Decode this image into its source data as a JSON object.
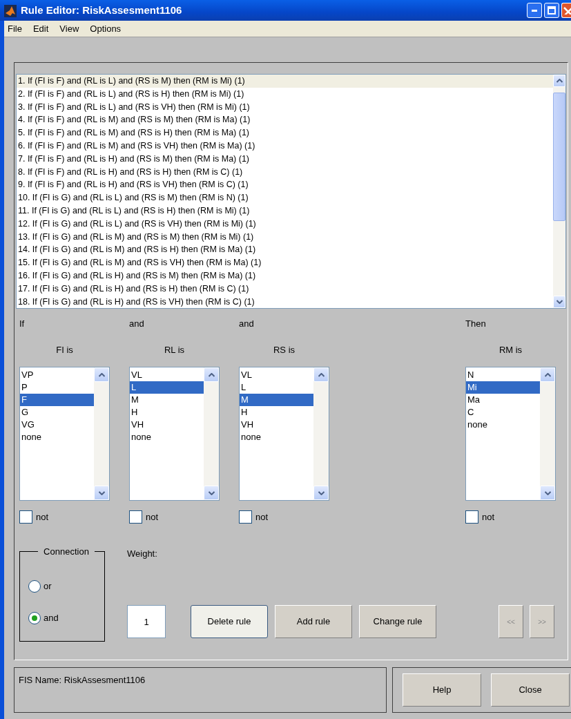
{
  "window": {
    "title": "Rule Editor: RiskAssesment1106"
  },
  "menu": [
    "File",
    "Edit",
    "View",
    "Options"
  ],
  "rules": [
    {
      "text": "1. If (FI is F) and (RL is L) and (RS is M) then (RM is Mi) (1)",
      "selected": true
    },
    {
      "text": "2. If (FI is F) and (RL is L) and (RS is H) then (RM is Mi) (1)",
      "selected": false
    },
    {
      "text": "3. If (FI is F) and (RL is L) and (RS is VH) then (RM is Mi) (1)",
      "selected": false
    },
    {
      "text": "4. If (FI is F) and (RL is M) and (RS is M) then (RM is Ma) (1)",
      "selected": false
    },
    {
      "text": "5. If (FI is F) and (RL is M) and (RS is H) then (RM is Ma) (1)",
      "selected": false
    },
    {
      "text": "6. If (FI is F) and (RL is M) and (RS is VH) then (RM is Ma) (1)",
      "selected": false
    },
    {
      "text": "7. If (FI is F) and (RL is H) and (RS is M) then (RM is Ma) (1)",
      "selected": false
    },
    {
      "text": "8. If (FI is F) and (RL is H) and (RS is H) then (RM is C) (1)",
      "selected": false
    },
    {
      "text": "9. If (FI is F) and (RL is H) and (RS is VH) then (RM is C) (1)",
      "selected": false
    },
    {
      "text": "10. If (FI is G) and (RL is L) and (RS is M) then (RM is N) (1)",
      "selected": false
    },
    {
      "text": "11. If (FI is G) and (RL is L) and (RS is H) then (RM is Mi) (1)",
      "selected": false
    },
    {
      "text": "12. If (FI is G) and (RL is L) and (RS is VH) then (RM is Mi) (1)",
      "selected": false
    },
    {
      "text": "13. If (FI is G) and (RL is M) and (RS is M) then (RM is Mi) (1)",
      "selected": false
    },
    {
      "text": "14. If (FI is G) and (RL is M) and (RS is H) then (RM is Ma) (1)",
      "selected": false
    },
    {
      "text": "15. If (FI is G) and (RL is M) and (RS is VH) then (RM is Ma) (1)",
      "selected": false
    },
    {
      "text": "16. If (FI is G) and (RL is H) and (RS is M) then (RM is Ma) (1)",
      "selected": false
    },
    {
      "text": "17. If (FI is G) and (RL is H) and (RS is H) then (RM is C) (1)",
      "selected": false
    },
    {
      "text": "18. If (FI is G) and (RL is H) and (RS is VH) then (RM is C) (1)",
      "selected": false
    }
  ],
  "columns": [
    {
      "connective": "If",
      "label": "FI is",
      "options": [
        {
          "text": "VP",
          "selected": false
        },
        {
          "text": "P",
          "selected": false
        },
        {
          "text": "F",
          "selected": true
        },
        {
          "text": "G",
          "selected": false
        },
        {
          "text": "VG",
          "selected": false
        },
        {
          "text": "none",
          "selected": false
        }
      ],
      "not": {
        "label": "not",
        "checked": false
      }
    },
    {
      "connective": "and",
      "label": "RL is",
      "options": [
        {
          "text": "VL",
          "selected": false
        },
        {
          "text": "L",
          "selected": true
        },
        {
          "text": "M",
          "selected": false
        },
        {
          "text": "H",
          "selected": false
        },
        {
          "text": "VH",
          "selected": false
        },
        {
          "text": "none",
          "selected": false
        }
      ],
      "not": {
        "label": "not",
        "checked": false
      }
    },
    {
      "connective": "and",
      "label": "RS is",
      "options": [
        {
          "text": "VL",
          "selected": false
        },
        {
          "text": "L",
          "selected": false
        },
        {
          "text": "M",
          "selected": true
        },
        {
          "text": "H",
          "selected": false
        },
        {
          "text": "VH",
          "selected": false
        },
        {
          "text": "none",
          "selected": false
        }
      ],
      "not": {
        "label": "not",
        "checked": false
      }
    },
    {
      "connective": "Then",
      "label": "RM is",
      "options": [
        {
          "text": "N",
          "selected": false
        },
        {
          "text": "Mi",
          "selected": true
        },
        {
          "text": "Ma",
          "selected": false
        },
        {
          "text": "C",
          "selected": false
        },
        {
          "text": "none",
          "selected": false
        }
      ],
      "not": {
        "label": "not",
        "checked": false
      }
    }
  ],
  "connection": {
    "title": "Connection",
    "options": [
      {
        "label": "or",
        "selected": false
      },
      {
        "label": "and",
        "selected": true
      }
    ]
  },
  "weight": {
    "label": "Weight:",
    "value": "1"
  },
  "actions": [
    {
      "label": "Delete rule",
      "focused": true
    },
    {
      "label": "Add rule",
      "focused": false
    },
    {
      "label": "Change rule",
      "focused": false
    }
  ],
  "nav": [
    {
      "label": "<<",
      "disabled": true
    },
    {
      "label": ">>",
      "disabled": true
    }
  ],
  "status": "FIS Name: RiskAssesment1106",
  "footer_buttons": [
    "Help",
    "Close"
  ]
}
